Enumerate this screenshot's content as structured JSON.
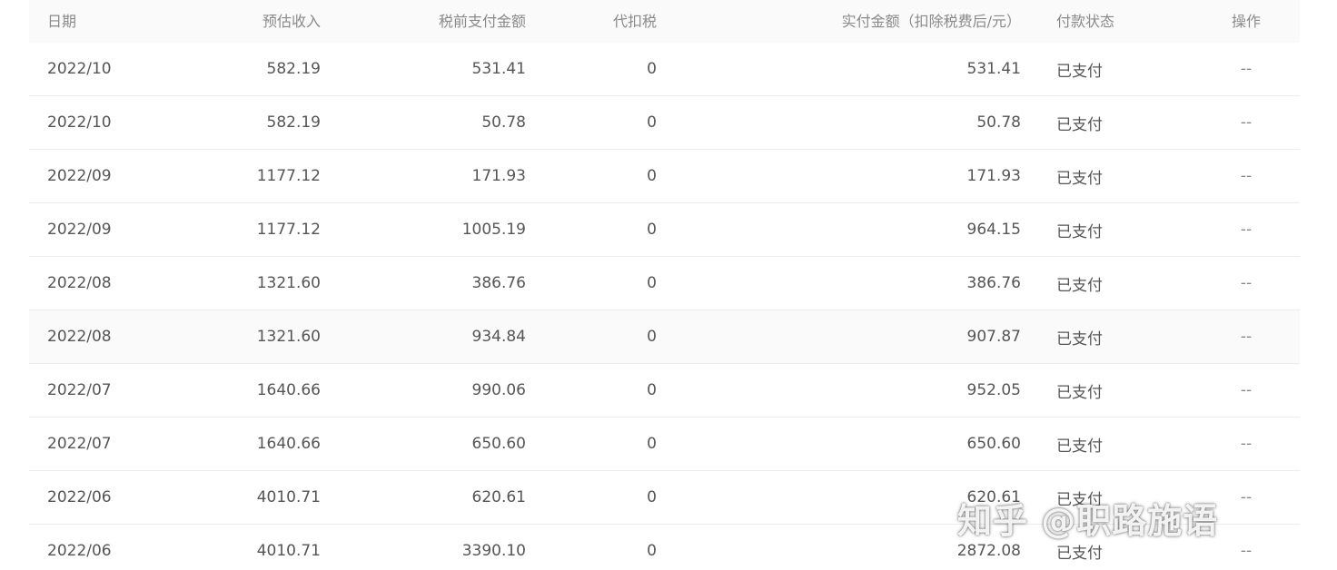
{
  "table": {
    "headers": {
      "date": "日期",
      "estimated_income": "预估收入",
      "pre_tax_amount": "税前支付金额",
      "withheld_tax": "代扣税",
      "actual_paid": "实付金额（扣除税费后/元）",
      "payment_status": "付款状态",
      "operation": "操作"
    },
    "rows": [
      {
        "date": "2022/10",
        "estimated_income": "582.19",
        "pre_tax_amount": "531.41",
        "withheld_tax": "0",
        "actual_paid": "531.41",
        "payment_status": "已支付",
        "operation": "--"
      },
      {
        "date": "2022/10",
        "estimated_income": "582.19",
        "pre_tax_amount": "50.78",
        "withheld_tax": "0",
        "actual_paid": "50.78",
        "payment_status": "已支付",
        "operation": "--"
      },
      {
        "date": "2022/09",
        "estimated_income": "1177.12",
        "pre_tax_amount": "171.93",
        "withheld_tax": "0",
        "actual_paid": "171.93",
        "payment_status": "已支付",
        "operation": "--"
      },
      {
        "date": "2022/09",
        "estimated_income": "1177.12",
        "pre_tax_amount": "1005.19",
        "withheld_tax": "0",
        "actual_paid": "964.15",
        "payment_status": "已支付",
        "operation": "--"
      },
      {
        "date": "2022/08",
        "estimated_income": "1321.60",
        "pre_tax_amount": "386.76",
        "withheld_tax": "0",
        "actual_paid": "386.76",
        "payment_status": "已支付",
        "operation": "--"
      },
      {
        "date": "2022/08",
        "estimated_income": "1321.60",
        "pre_tax_amount": "934.84",
        "withheld_tax": "0",
        "actual_paid": "907.87",
        "payment_status": "已支付",
        "operation": "--"
      },
      {
        "date": "2022/07",
        "estimated_income": "1640.66",
        "pre_tax_amount": "990.06",
        "withheld_tax": "0",
        "actual_paid": "952.05",
        "payment_status": "已支付",
        "operation": "--"
      },
      {
        "date": "2022/07",
        "estimated_income": "1640.66",
        "pre_tax_amount": "650.60",
        "withheld_tax": "0",
        "actual_paid": "650.60",
        "payment_status": "已支付",
        "operation": "--"
      },
      {
        "date": "2022/06",
        "estimated_income": "4010.71",
        "pre_tax_amount": "620.61",
        "withheld_tax": "0",
        "actual_paid": "620.61",
        "payment_status": "已支付",
        "operation": "--"
      },
      {
        "date": "2022/06",
        "estimated_income": "4010.71",
        "pre_tax_amount": "3390.10",
        "withheld_tax": "0",
        "actual_paid": "2872.08",
        "payment_status": "已支付",
        "operation": "--"
      }
    ]
  },
  "watermark": {
    "text": "知乎 @职路施语"
  }
}
